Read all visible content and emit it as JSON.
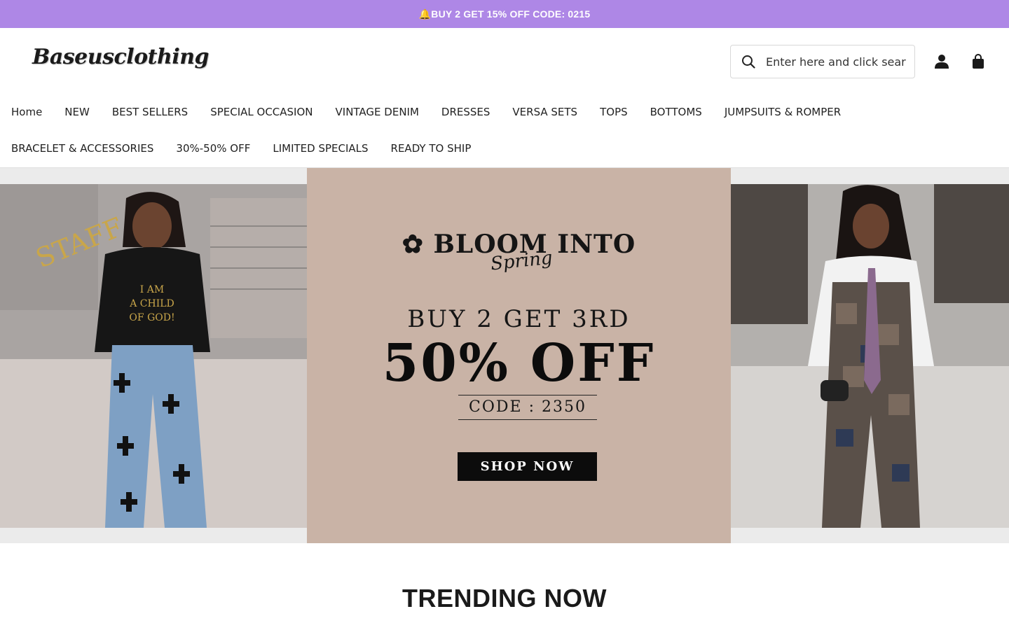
{
  "announcement": {
    "text": "🔔BUY 2 GET 15% OFF CODE: 0215",
    "bg_color": "#ae87e6"
  },
  "header": {
    "logo_text": "Baseusclothing",
    "search": {
      "placeholder": "Enter here and click search",
      "icon": "search-icon"
    },
    "icons": [
      "account-icon",
      "cart-bag-icon"
    ]
  },
  "nav": {
    "row1": [
      "Home",
      "NEW",
      "BEST SELLERS",
      "SPECIAL OCCASION",
      "VINTAGE DENIM",
      "DRESSES",
      "VERSA SETS",
      "TOPS",
      "BOTTOMS",
      "JUMPSUITS & ROMPER"
    ],
    "row2": [
      "BRACELET & ACCESSORIES",
      "30%-50% OFF",
      "LIMITED SPECIALS",
      "READY TO SHIP"
    ]
  },
  "hero": {
    "bloom_title": "BLOOM INTO",
    "bloom_script": "Spring",
    "offer_line1": "BUY 2 GET 3RD",
    "offer_line2": "50% OFF",
    "code_text": "CODE : 2350",
    "cta_label": "SHOP NOW",
    "left_image": {
      "sweatshirt_text": [
        "I AM",
        "A CHILD",
        "OF GOD!"
      ],
      "sign_text": "STAFF"
    },
    "bg_color": "#c9b3a6"
  },
  "sections": {
    "trending_title": "TRENDING NOW"
  }
}
